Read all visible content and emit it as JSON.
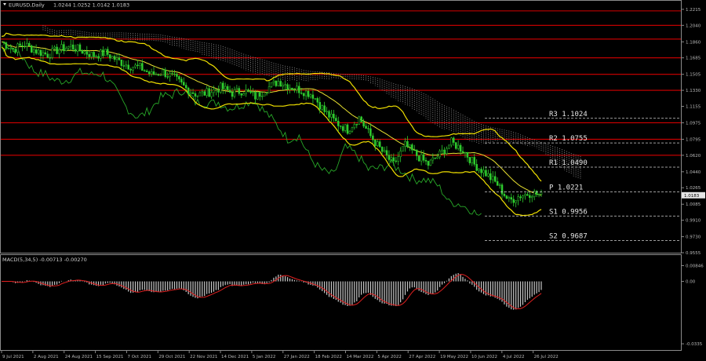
{
  "window": {
    "title": "EURUSD,Daily",
    "ohlc": "1.0244 1.0252 1.0142 1.0183"
  },
  "macd_panel": {
    "title": "MACD(5,34,5) -0.00713 -0.00270"
  },
  "colors": {
    "background": "#000000",
    "border": "#8a8a8a",
    "candle": "#2ecc2e",
    "chikou": "#28a828",
    "bollinger": "#f0e000",
    "kijun": "#e8e030",
    "cloud": "#9a9a9a",
    "level_red": "#d40000",
    "macd_hist": "#c8c8c8",
    "macd_signal": "#e02020",
    "pivot": "#d0d0d0"
  },
  "chart_data": [
    {
      "type": "line",
      "title": "EURUSD,Daily",
      "x_ticks": [
        "9 Jul 2021",
        "2 Aug 2021",
        "24 Aug 2021",
        "15 Sep 2021",
        "7 Oct 2021",
        "29 Oct 2021",
        "22 Nov 2021",
        "14 Dec 2021",
        "5 Jan 2022",
        "27 Jan 2022",
        "18 Feb 2022",
        "14 Mar 2022",
        "5 Apr 2022",
        "27 Apr 2022",
        "19 May 2022",
        "10 Jun 2022",
        "4 Jul 2022",
        "26 Jul 2022"
      ],
      "y_ticks": [
        "1.2215",
        "1.2040",
        "1.1860",
        "1.1685",
        "1.1505",
        "1.1330",
        "1.1155",
        "1.0975",
        "1.0795",
        "1.0620",
        "1.0440",
        "1.0265",
        "1.0085",
        "0.9910",
        "0.9730",
        "0.9555"
      ],
      "ylim": [
        0.9555,
        1.23
      ],
      "current_price": "1.0183",
      "price_path": [
        [
          0,
          1.186
        ],
        [
          5,
          1.178
        ],
        [
          10,
          1.183
        ],
        [
          15,
          1.176
        ],
        [
          20,
          1.172
        ],
        [
          25,
          1.178
        ],
        [
          30,
          1.181
        ],
        [
          35,
          1.176
        ],
        [
          40,
          1.171
        ],
        [
          45,
          1.174
        ],
        [
          50,
          1.166
        ],
        [
          55,
          1.16
        ],
        [
          60,
          1.158
        ],
        [
          65,
          1.15
        ],
        [
          70,
          1.153
        ],
        [
          75,
          1.146
        ],
        [
          80,
          1.135
        ],
        [
          85,
          1.128
        ],
        [
          90,
          1.131
        ],
        [
          95,
          1.136
        ],
        [
          100,
          1.13
        ],
        [
          105,
          1.133
        ],
        [
          110,
          1.126
        ],
        [
          115,
          1.135
        ],
        [
          120,
          1.143
        ],
        [
          125,
          1.137
        ],
        [
          130,
          1.133
        ],
        [
          135,
          1.128
        ],
        [
          140,
          1.11
        ],
        [
          145,
          1.098
        ],
        [
          150,
          1.09
        ],
        [
          155,
          1.103
        ],
        [
          160,
          1.083
        ],
        [
          165,
          1.066
        ],
        [
          170,
          1.052
        ],
        [
          175,
          1.073
        ],
        [
          180,
          1.062
        ],
        [
          185,
          1.052
        ],
        [
          190,
          1.063
        ],
        [
          195,
          1.076
        ],
        [
          200,
          1.068
        ],
        [
          205,
          1.052
        ],
        [
          210,
          1.042
        ],
        [
          215,
          1.03
        ],
        [
          220,
          1.012
        ],
        [
          225,
          1.018
        ],
        [
          230,
          1.021
        ],
        [
          234,
          1.018
        ]
      ],
      "resistance_levels": [
        "1.2040",
        "1.1890",
        "1.1685",
        "1.1505",
        "1.1330",
        "1.0975",
        "1.0795",
        "1.0620"
      ],
      "pivot_levels": [
        {
          "label": "R3",
          "value": "1.1024"
        },
        {
          "label": "R2",
          "value": "1.0755"
        },
        {
          "label": "R1",
          "value": "1.0490"
        },
        {
          "label": "P",
          "value": "1.0221"
        },
        {
          "label": "S1",
          "value": "0.9956"
        },
        {
          "label": "S2",
          "value": "0.9687"
        }
      ]
    },
    {
      "type": "bar",
      "title": "MACD(5,34,5) -0.00713 -0.00270",
      "y_ticks": [
        "0.00846",
        "0.00",
        "-0.0335"
      ],
      "ylim": [
        -0.036,
        0.0095
      ]
    }
  ]
}
